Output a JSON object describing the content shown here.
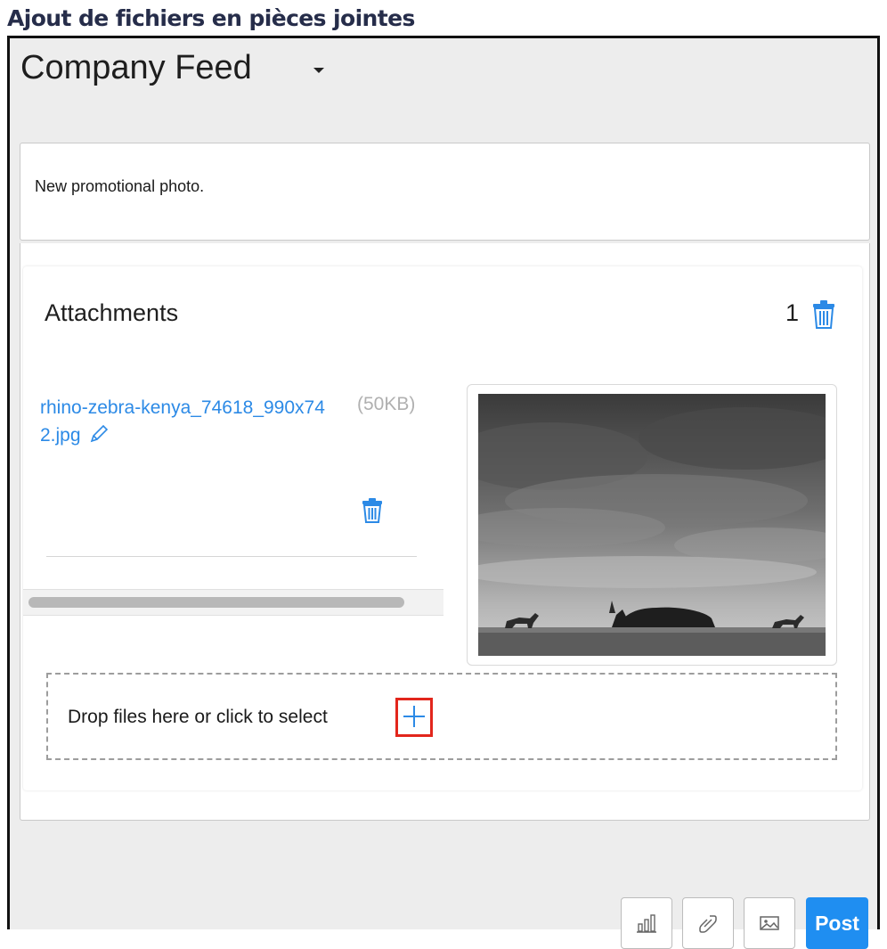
{
  "heading": "Ajout de fichiers en pièces jointes",
  "feed": {
    "title": "Company Feed"
  },
  "composer": {
    "message": "New promotional photo."
  },
  "attachments": {
    "title": "Attachments",
    "count": "1",
    "file": {
      "name": "rhino-zebra-kenya_74618_990x742.jpg",
      "size": "(50KB)"
    },
    "drop_zone_text": "Drop files here or click to select"
  },
  "toolbar": {
    "post_label": "Post"
  },
  "colors": {
    "accent": "#1f8ef1",
    "link": "#2c8ae6",
    "highlight": "#e2261c",
    "background": "#ededed"
  },
  "icons": [
    "chevron-down-icon",
    "trash-icon",
    "pencil-icon",
    "plus-icon",
    "poll-icon",
    "link-icon",
    "image-icon"
  ]
}
